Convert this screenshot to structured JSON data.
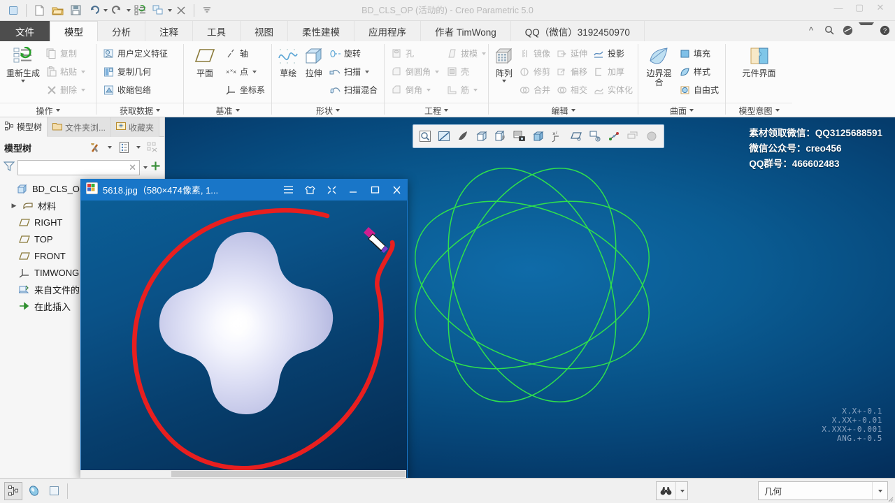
{
  "window": {
    "title": "BD_CLS_OP (活动的) - Creo Parametric 5.0",
    "quick_access": [
      {
        "name": "app-menu-icon",
        "glyph": "▢"
      },
      {
        "name": "new-file-icon",
        "glyph": "📄"
      },
      {
        "name": "open-file-icon",
        "glyph": "📂"
      },
      {
        "name": "save-icon",
        "glyph": "💾"
      },
      {
        "name": "undo-icon",
        "glyph": "↶"
      },
      {
        "name": "redo-icon",
        "glyph": "↷"
      },
      {
        "name": "regenerate-icon",
        "glyph": "▤"
      },
      {
        "name": "window-switch-icon",
        "glyph": "❐"
      },
      {
        "name": "close-window-icon",
        "glyph": "✕"
      },
      {
        "name": "customize-qat-icon",
        "glyph": "▾"
      }
    ],
    "controls": {
      "minimize": "—",
      "maximize": "▢",
      "close": "✕",
      "collapse_ribbon": "^",
      "search": "🔍",
      "account": "◕",
      "help": "?"
    }
  },
  "ribbon": {
    "tabs": [
      {
        "label": "文件",
        "type": "file"
      },
      {
        "label": "模型",
        "type": "active"
      },
      {
        "label": "分析",
        "type": "normal"
      },
      {
        "label": "注释",
        "type": "normal"
      },
      {
        "label": "工具",
        "type": "normal"
      },
      {
        "label": "视图",
        "type": "normal"
      },
      {
        "label": "柔性建模",
        "type": "normal"
      },
      {
        "label": "应用程序",
        "type": "normal"
      },
      {
        "label": "作者 TimWong",
        "type": "normal"
      },
      {
        "label": "QQ（微信）3192450970",
        "type": "normal"
      }
    ],
    "groups": [
      {
        "label": "操作",
        "big": {
          "label": "重新生成",
          "icon": "regenerate-icon",
          "has_dropdown": true
        },
        "items": [
          {
            "label": "复制",
            "icon": "copy-icon",
            "disabled": true,
            "dropdown": false
          },
          {
            "label": "粘贴",
            "icon": "paste-icon",
            "disabled": true,
            "dropdown": true
          },
          {
            "label": "删除",
            "icon": "delete-icon",
            "disabled": true,
            "dropdown": true
          }
        ]
      },
      {
        "label": "获取数据",
        "items": [
          {
            "label": "用户定义特征",
            "icon": "udf-icon",
            "disabled": false,
            "dropdown": false
          },
          {
            "label": "复制几何",
            "icon": "copy-geometry-icon",
            "disabled": false,
            "dropdown": false
          },
          {
            "label": "收缩包络",
            "icon": "shrinkwrap-icon",
            "disabled": false,
            "dropdown": false
          }
        ]
      },
      {
        "label": "基准",
        "big": {
          "label": "平面",
          "icon": "datum-plane-icon",
          "has_dropdown": false
        },
        "items": [
          {
            "label": "轴",
            "icon": "datum-axis-icon",
            "disabled": false,
            "dropdown": false
          },
          {
            "label": "点",
            "icon": "datum-point-icon",
            "disabled": false,
            "dropdown": true
          },
          {
            "label": "坐标系",
            "icon": "coordinate-system-icon",
            "disabled": false,
            "dropdown": false
          }
        ]
      },
      {
        "label": "形状",
        "big2": [
          {
            "label": "草绘",
            "icon": "sketch-icon"
          },
          {
            "label": "拉伸",
            "icon": "extrude-icon"
          }
        ],
        "items": [
          {
            "label": "旋转",
            "icon": "revolve-icon",
            "disabled": false,
            "dropdown": false
          },
          {
            "label": "扫描",
            "icon": "sweep-icon",
            "disabled": false,
            "dropdown": true
          },
          {
            "label": "扫描混合",
            "icon": "swept-blend-icon",
            "disabled": false,
            "dropdown": false
          }
        ]
      },
      {
        "label": "工程",
        "cols": [
          [
            {
              "label": "孔",
              "icon": "hole-icon",
              "disabled": true,
              "dropdown": false
            },
            {
              "label": "倒圆角",
              "icon": "round-icon",
              "disabled": true,
              "dropdown": true
            },
            {
              "label": "倒角",
              "icon": "chamfer-icon",
              "disabled": true,
              "dropdown": true
            }
          ],
          [
            {
              "label": "拔模",
              "icon": "draft-icon",
              "disabled": true,
              "dropdown": true
            },
            {
              "label": "壳",
              "icon": "shell-icon",
              "disabled": true,
              "dropdown": false
            },
            {
              "label": "筋",
              "icon": "rib-icon",
              "disabled": true,
              "dropdown": true
            }
          ]
        ]
      },
      {
        "label": "编辑",
        "big": {
          "label": "阵列",
          "icon": "pattern-icon",
          "has_dropdown": true
        },
        "cols": [
          [
            {
              "label": "镜像",
              "icon": "mirror-icon",
              "disabled": true,
              "dropdown": false
            },
            {
              "label": "修剪",
              "icon": "trim-icon",
              "disabled": true,
              "dropdown": false
            },
            {
              "label": "合并",
              "icon": "merge-icon",
              "disabled": true,
              "dropdown": false
            }
          ],
          [
            {
              "label": "延伸",
              "icon": "extend-icon",
              "disabled": true,
              "dropdown": false
            },
            {
              "label": "偏移",
              "icon": "offset-icon",
              "disabled": true,
              "dropdown": false
            },
            {
              "label": "相交",
              "icon": "intersect-icon",
              "disabled": true,
              "dropdown": false
            }
          ],
          [
            {
              "label": "投影",
              "icon": "project-icon",
              "disabled": false,
              "dropdown": false
            },
            {
              "label": "加厚",
              "icon": "thicken-icon",
              "disabled": true,
              "dropdown": false
            },
            {
              "label": "实体化",
              "icon": "solidify-icon",
              "disabled": true,
              "dropdown": false
            }
          ]
        ]
      },
      {
        "label": "曲面",
        "big": {
          "label": "边界混合",
          "icon": "boundary-blend-icon",
          "has_dropdown": false
        },
        "items": [
          {
            "label": "填充",
            "icon": "fill-icon",
            "disabled": false,
            "dropdown": false
          },
          {
            "label": "样式",
            "icon": "style-icon",
            "disabled": false,
            "dropdown": false
          },
          {
            "label": "自由式",
            "icon": "freestyle-icon",
            "disabled": false,
            "dropdown": false
          }
        ]
      },
      {
        "label": "模型意图",
        "big": {
          "label": "元件界面",
          "icon": "component-interface-icon",
          "has_dropdown": false
        },
        "items": []
      }
    ]
  },
  "left_panel": {
    "nav_tabs": [
      {
        "label": "模型树",
        "icon": "model-tree-icon",
        "active": true
      },
      {
        "label": "文件夹浏...",
        "icon": "folder-browser-icon",
        "active": false
      },
      {
        "label": "收藏夹",
        "icon": "favorites-icon",
        "active": false
      }
    ],
    "tree_header": {
      "title": "模型树",
      "tools_icon": "tools-icon",
      "settings_icon": "settings-list-icon",
      "display_icon": "display-filter-icon"
    },
    "filter": {
      "icon": "filter-icon",
      "value": "",
      "placeholder": "",
      "clear_icon": "clear-icon",
      "dropdown_icon": "chevron-down-icon",
      "add_icon": "plus-icon"
    },
    "tree_items": [
      {
        "label": "BD_CLS_OP.PRT",
        "icon": "part-icon",
        "indent": 0,
        "expander": ""
      },
      {
        "label": "材料",
        "icon": "material-icon",
        "indent": 1,
        "expander": "▶"
      },
      {
        "label": "RIGHT",
        "icon": "datum-plane-icon",
        "indent": 1,
        "expander": ""
      },
      {
        "label": "TOP",
        "icon": "datum-plane-icon",
        "indent": 1,
        "expander": ""
      },
      {
        "label": "FRONT",
        "icon": "datum-plane-icon",
        "indent": 1,
        "expander": ""
      },
      {
        "label": "TIMWONG",
        "icon": "coordinate-system-icon",
        "indent": 1,
        "expander": ""
      },
      {
        "label": "来自文件的曲...",
        "icon": "import-feature-icon",
        "indent": 1,
        "expander": ""
      },
      {
        "label": "在此插入",
        "icon": "insert-here-icon",
        "indent": 1,
        "expander": ""
      }
    ]
  },
  "viewport": {
    "toolbar_icons": [
      {
        "name": "refit-icon",
        "glyph": "🔍"
      },
      {
        "name": "zoom-in-icon",
        "glyph": "◤"
      },
      {
        "name": "repaint-icon",
        "glyph": "✎"
      },
      {
        "name": "display-style-shaded-icon",
        "glyph": "▣"
      },
      {
        "name": "saved-orientation-icon",
        "glyph": "▥"
      },
      {
        "name": "view-manager-icon",
        "glyph": "📷"
      },
      {
        "name": "perspective-view-icon",
        "glyph": "◱"
      },
      {
        "name": "datum-display-icon",
        "glyph": "✕"
      },
      {
        "name": "plane-display-icon",
        "glyph": "▱"
      },
      {
        "name": "annotation-display-icon",
        "glyph": "▤"
      },
      {
        "name": "spin-center-icon",
        "glyph": "•"
      },
      {
        "name": "layer-display-icon",
        "glyph": "▦"
      },
      {
        "name": "appearance-gallery-icon",
        "glyph": "●"
      }
    ],
    "promo_lines": [
      "素材领取微信：QQ3125688591",
      "微信公众号：creo456",
      "QQ群号：466602483"
    ],
    "tolerance_lines": [
      "X.X+-0.1",
      "X.XX+-0.01",
      "X.XXX+-0.001",
      "ANG.+-0.5"
    ],
    "curve_color": "#2fe04c"
  },
  "image_viewer": {
    "title": "5618.jpg（580×474像素, 1...",
    "icon": "image-file-icon",
    "controls": [
      {
        "name": "menu-icon",
        "glyph": "≡"
      },
      {
        "name": "shirt-icon",
        "glyph": "♘"
      },
      {
        "name": "fullscreen-icon",
        "glyph": "⤢"
      },
      {
        "name": "minimize-icon",
        "glyph": "—"
      },
      {
        "name": "maximize-icon",
        "glyph": "▢"
      },
      {
        "name": "close-icon",
        "glyph": "✕"
      }
    ],
    "annotation_color": "#e81f1f"
  },
  "status_bar": {
    "left_buttons": [
      {
        "name": "model-tree-toggle-icon",
        "glyph": "⁙",
        "selected": true
      },
      {
        "name": "appearance-icon",
        "glyph": "◉",
        "selected": false
      },
      {
        "name": "display-style-icon",
        "glyph": "▢",
        "selected": false
      }
    ],
    "find_label": "",
    "find_icon": "binoculars-icon",
    "selection_filter": "几何",
    "resize_grip_icon": "resize-grip-icon"
  }
}
